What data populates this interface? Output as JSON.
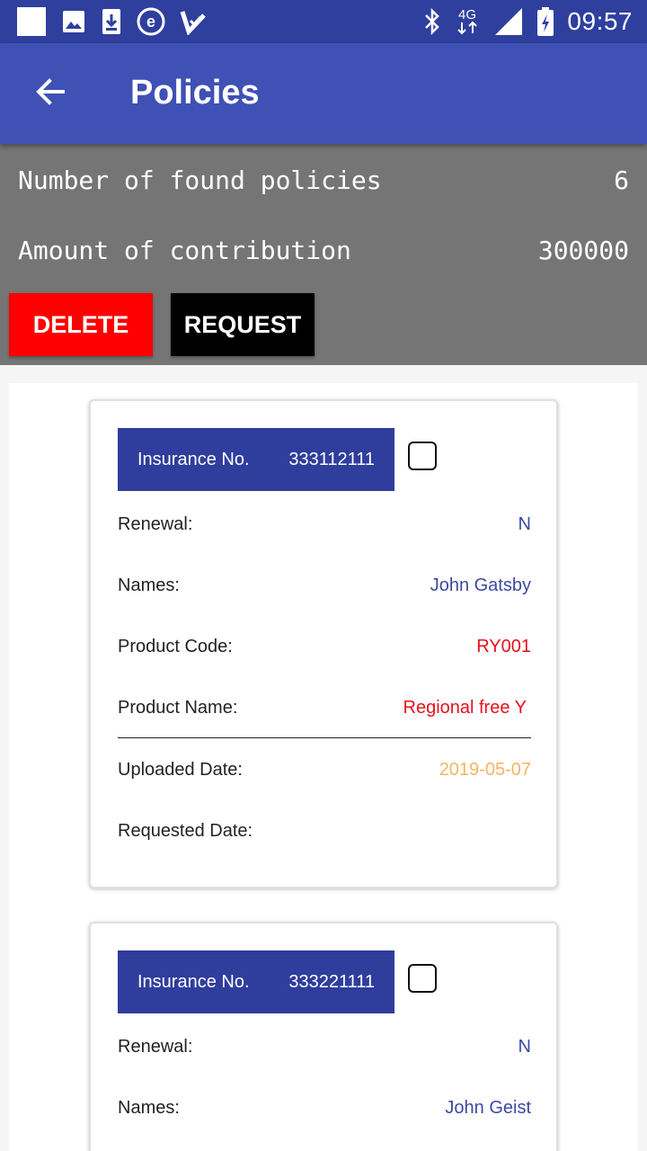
{
  "status_bar": {
    "time": "09:57",
    "network": "4G",
    "left_icons": [
      "square-notification-icon",
      "image-icon",
      "download-icon",
      "e-app-icon",
      "check-app-icon"
    ],
    "right_icons": [
      "bluetooth-icon",
      "network-4g-icon",
      "signal-icon",
      "battery-icon"
    ]
  },
  "app_bar": {
    "title": "Policies",
    "back_icon": "arrow-back-icon"
  },
  "summary": {
    "found_label": "Number of found policies",
    "found_value": "6",
    "amount_label": "Amount of contribution",
    "amount_value": "300000"
  },
  "actions": {
    "delete_label": "DELETE",
    "request_label": "REQUEST"
  },
  "colors": {
    "primary": "#3f51b5",
    "status_bar": "#2f3f9e",
    "summary_bg": "#757575",
    "delete": "#ff0000",
    "request": "#000000",
    "header_blue": "#2f3d9d",
    "value_blue": "#3b4aa3",
    "value_red": "#e8101e",
    "value_orange": "#f3b563"
  },
  "policies": [
    {
      "insurance_label": "Insurance No.",
      "insurance_no": "333112111",
      "renewal_label": "Renewal:",
      "renewal": "N",
      "names_label": "Names:",
      "names": "John Gatsby",
      "product_code_label": "Product Code:",
      "product_code": "RY001",
      "product_name_label": "Product Name:",
      "product_name": "Regional free Y",
      "uploaded_label": "Uploaded Date:",
      "uploaded": "2019-05-07",
      "requested_label": "Requested Date:",
      "requested": ""
    },
    {
      "insurance_label": "Insurance No.",
      "insurance_no": "333221111",
      "renewal_label": "Renewal:",
      "renewal": "N",
      "names_label": "Names:",
      "names": "John Geist"
    }
  ]
}
